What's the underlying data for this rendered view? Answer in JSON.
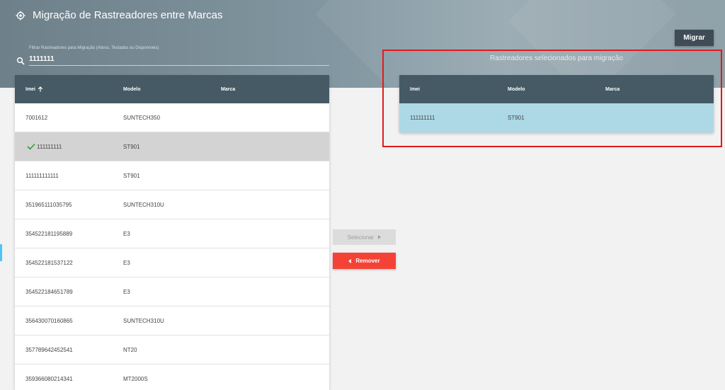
{
  "header": {
    "title": "Migração de Rastreadores entre Marcas",
    "icon": "gps-target-icon",
    "migrar_label": "Migrar"
  },
  "filter": {
    "label": "Filtrar Rastreadores para Migração (Ativos, Testados ou Disponíveis)",
    "value": "1111111"
  },
  "left_table": {
    "columns": {
      "imei": "Imei",
      "modelo": "Modelo",
      "marca": "Marca"
    },
    "sort_icon": "arrow-up-icon",
    "rows": [
      {
        "imei": "7001612",
        "modelo": "SUNTECH350",
        "marca": ""
      },
      {
        "imei": "111111111",
        "modelo": "ST901",
        "marca": ""
      },
      {
        "imei": "111111111111",
        "modelo": "ST901",
        "marca": ""
      },
      {
        "imei": "351965111035795",
        "modelo": "SUNTECH310U",
        "marca": ""
      },
      {
        "imei": "354522181195889",
        "modelo": "E3",
        "marca": ""
      },
      {
        "imei": "354522181537122",
        "modelo": "E3",
        "marca": ""
      },
      {
        "imei": "354522184651789",
        "modelo": "E3",
        "marca": ""
      },
      {
        "imei": "356430070160865",
        "modelo": "SUNTECH310U",
        "marca": ""
      },
      {
        "imei": "357789642452541",
        "modelo": "NT20",
        "marca": ""
      },
      {
        "imei": "359366080214341",
        "modelo": "MT2000S",
        "marca": ""
      }
    ]
  },
  "actions": {
    "selecionar_label": "Selecionar",
    "remover_label": "Remover"
  },
  "right_table": {
    "heading": "Rastreadores selecionados para migração",
    "columns": {
      "imei": "Imei",
      "modelo": "Modelo",
      "marca": "Marca"
    },
    "rows": [
      {
        "imei": "111111111",
        "modelo": "ST901",
        "marca": ""
      }
    ]
  },
  "colors": {
    "header_bg": "#455a64",
    "selected_row": "#d3d3d3",
    "chosen_row": "#add8e6",
    "remove_button": "#f44336",
    "highlight": "#e01b1b",
    "check": "#2e9e3a"
  }
}
